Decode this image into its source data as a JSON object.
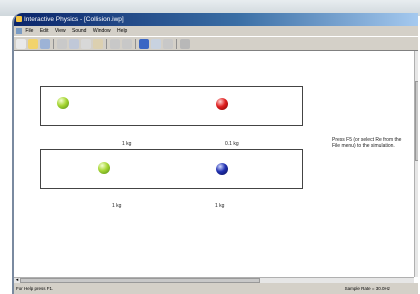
{
  "window": {
    "title": "Interactive Physics - [Collision.iwp]"
  },
  "menu": {
    "items": [
      "File",
      "Edit",
      "View",
      "Sound",
      "Window",
      "Help"
    ]
  },
  "toolbar": {
    "buttons": [
      {
        "icon": "new-icon",
        "color": "#e9e9e9"
      },
      {
        "icon": "open-icon",
        "color": "#f2d36b"
      },
      {
        "icon": "save-icon",
        "color": "#9db3d6"
      },
      {
        "icon": "print-icon",
        "color": "#c9c9c9"
      },
      {
        "icon": "cut-icon",
        "color": "#c0c8d8"
      },
      {
        "icon": "copy-icon",
        "color": "#d8d8d8"
      },
      {
        "icon": "paste-icon",
        "color": "#dcd0b0"
      },
      {
        "icon": "undo-icon",
        "color": "#c8c8c8"
      },
      {
        "icon": "redo-icon",
        "color": "#c8c8c8"
      },
      {
        "icon": "run-icon",
        "color": "#3a66c4"
      },
      {
        "icon": "chart-icon",
        "color": "#c8d2e0"
      },
      {
        "icon": "help-icon",
        "color": "#c8c8c8"
      },
      {
        "icon": "grid-icon",
        "color": "#b8b8b8"
      }
    ]
  },
  "simulation": {
    "panel1": {
      "left_ball": {
        "color": "green",
        "mass": "1 kg"
      },
      "right_ball": {
        "color": "red",
        "mass": "0.1 kg"
      }
    },
    "panel2": {
      "left_ball": {
        "color": "green",
        "mass": "1 kg"
      },
      "right_ball": {
        "color": "blue",
        "mass": "1 kg"
      }
    }
  },
  "hint_text": "Press F5 (or select Re from the File menu) to the simulation.",
  "status": {
    "left": "For Help press F1.",
    "right": "Sample Rate = 30.0Hz"
  }
}
